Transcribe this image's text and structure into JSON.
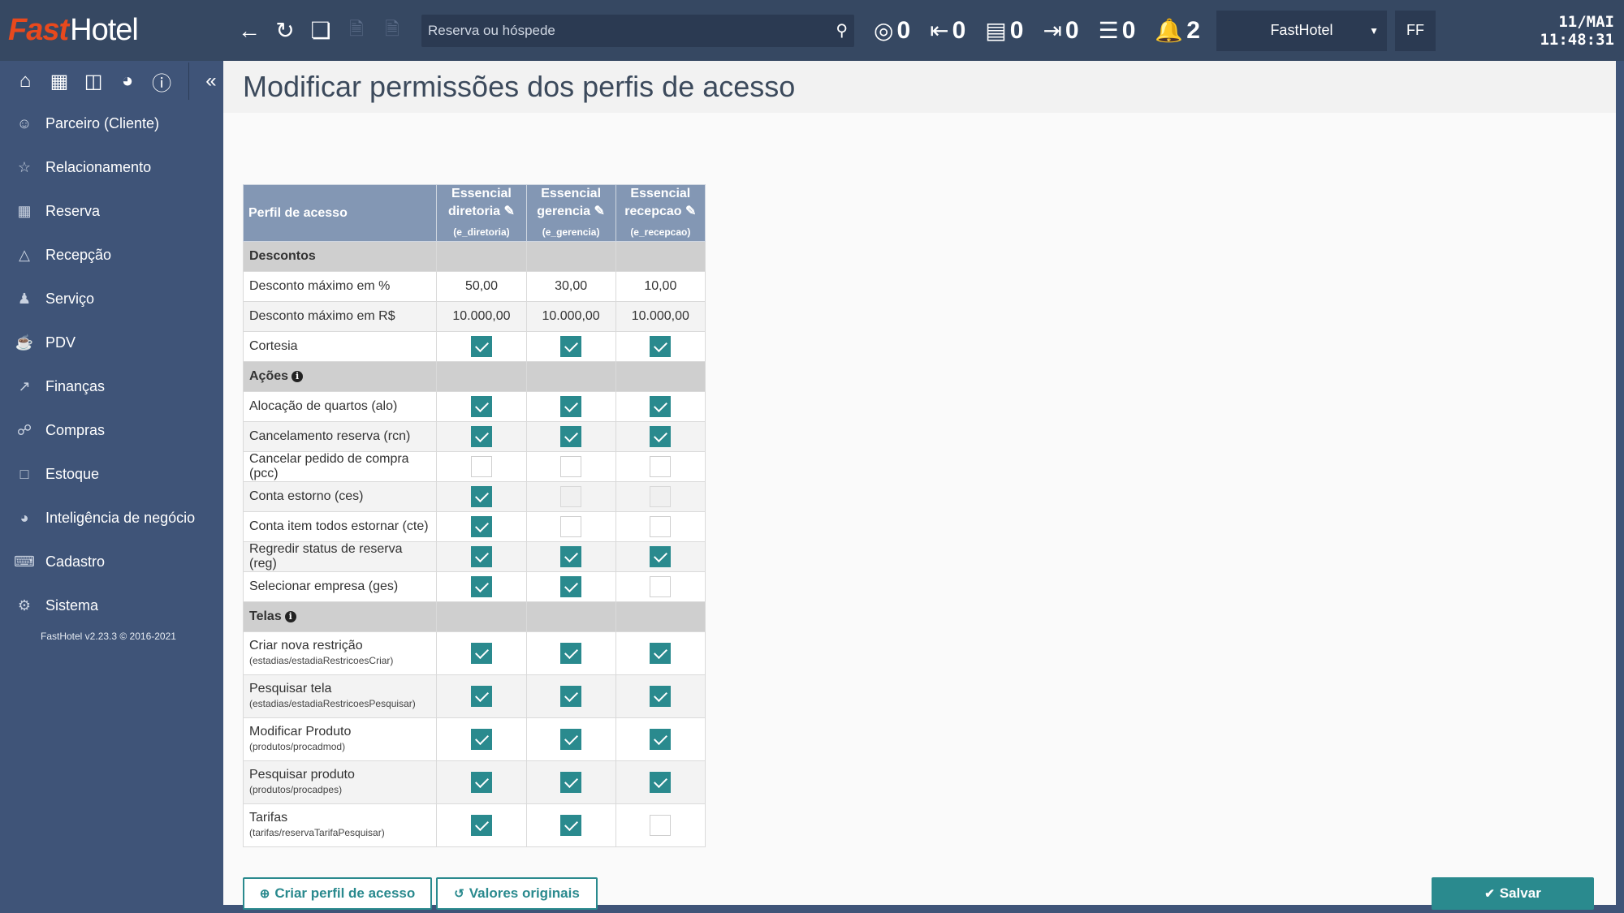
{
  "app": {
    "brand_first": "Fast",
    "brand_second": "Hotel"
  },
  "topbar": {
    "search_placeholder": "Reserva ou hóspede",
    "counters": [
      {
        "icon": "target-icon",
        "value": "0"
      },
      {
        "icon": "arrival-icon",
        "value": "0"
      },
      {
        "icon": "bed-icon",
        "value": "0"
      },
      {
        "icon": "departure-icon",
        "value": "0"
      },
      {
        "icon": "list-icon",
        "value": "0"
      },
      {
        "icon": "bell-icon",
        "value": "2"
      }
    ],
    "hotel": "FastHotel",
    "user_initials": "FF",
    "clock_date": "11/MAI",
    "clock_time": "11:48:31"
  },
  "sidebar": {
    "items": [
      {
        "label": "Parceiro (Cliente)"
      },
      {
        "label": "Relacionamento"
      },
      {
        "label": "Reserva"
      },
      {
        "label": "Recepção"
      },
      {
        "label": "Serviço"
      },
      {
        "label": "PDV"
      },
      {
        "label": "Finanças"
      },
      {
        "label": "Compras"
      },
      {
        "label": "Estoque"
      },
      {
        "label": "Inteligência de negócio"
      },
      {
        "label": "Cadastro"
      },
      {
        "label": "Sistema"
      }
    ],
    "version": "FastHotel v2.23.3 © 2016-2021"
  },
  "page": {
    "title": "Modificar permissões dos perfis de acesso"
  },
  "table": {
    "header_label": "Perfil de acesso",
    "profiles": [
      {
        "line1": "Essencial",
        "line2": "diretoria",
        "code": "(e_diretoria)"
      },
      {
        "line1": "Essencial",
        "line2": "gerencia",
        "code": "(e_gerencia)"
      },
      {
        "line1": "Essencial",
        "line2": "recepcao",
        "code": "(e_recepcao)"
      }
    ],
    "sections": {
      "descontos": "Descontos",
      "acoes": "Ações",
      "telas": "Telas"
    },
    "descontos": {
      "max_pct_label": "Desconto máximo em %",
      "max_pct": [
        "50,00",
        "30,00",
        "10,00"
      ],
      "max_rs_label": "Desconto máximo em R$",
      "max_rs": [
        "10.000,00",
        "10.000,00",
        "10.000,00"
      ],
      "cortesia_label": "Cortesia"
    },
    "acoes": [
      {
        "label": "Alocação de quartos (alo)"
      },
      {
        "label": "Cancelamento reserva (rcn)"
      },
      {
        "label": "Cancelar pedido de compra (pcc)"
      },
      {
        "label": "Conta estorno (ces)"
      },
      {
        "label": "Conta item todos estornar (cte)"
      },
      {
        "label": "Regredir status de reserva (reg)"
      },
      {
        "label": "Selecionar empresa (ges)"
      }
    ],
    "telas": [
      {
        "label": "Criar nova restrição",
        "path": "(estadias/estadiaRestricoesCriar)"
      },
      {
        "label": "Pesquisar tela",
        "path": "(estadias/estadiaRestricoesPesquisar)"
      },
      {
        "label": "Modificar Produto",
        "path": "(produtos/procadmod)"
      },
      {
        "label": "Pesquisar produto",
        "path": "(produtos/procadpes)"
      },
      {
        "label": "Tarifas",
        "path": "(tarifas/reservaTarifaPesquisar)"
      }
    ]
  },
  "buttons": {
    "create": "Criar perfil de acesso",
    "reset": "Valores originais",
    "save": "Salvar"
  },
  "colors": {
    "topbar": "#364862",
    "sidebar": "#3f5478",
    "accent": "#2a8a8e",
    "table_header": "#8397b4",
    "brand": "#e8491d"
  }
}
